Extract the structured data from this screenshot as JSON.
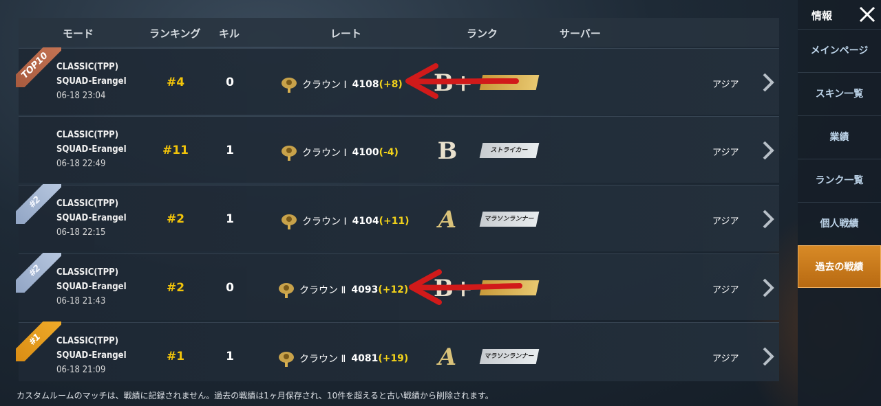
{
  "header": {
    "mode": "モード",
    "ranking": "ランキング",
    "kills": "キル",
    "rate": "レート",
    "rank": "ランク",
    "server": "サーバー"
  },
  "rows": [
    {
      "badge": "TOP10",
      "mode": "CLASSIC(TPP)",
      "map": "SQUAD-Erangel",
      "time": "06-18 23:04",
      "ranking": "#4",
      "kills": "0",
      "tier": "クラウン Ⅰ",
      "rate": "4108",
      "delta": "(+8)",
      "grade": "B+",
      "title": "",
      "server": "アジア"
    },
    {
      "badge": "",
      "mode": "CLASSIC(TPP)",
      "map": "SQUAD-Erangel",
      "time": "06-18 22:49",
      "ranking": "#11",
      "kills": "1",
      "tier": "クラウン Ⅰ",
      "rate": "4100",
      "delta": "(-4)",
      "grade": "B",
      "title": "ストライカー",
      "server": "アジア"
    },
    {
      "badge": "#2",
      "mode": "CLASSIC(TPP)",
      "map": "SQUAD-Erangel",
      "time": "06-18 22:15",
      "ranking": "#2",
      "kills": "1",
      "tier": "クラウン Ⅰ",
      "rate": "4104",
      "delta": "(+11)",
      "grade": "A",
      "title": "マラソンランナー",
      "server": "アジア"
    },
    {
      "badge": "#2",
      "mode": "CLASSIC(TPP)",
      "map": "SQUAD-Erangel",
      "time": "06-18 21:43",
      "ranking": "#2",
      "kills": "0",
      "tier": "クラウン Ⅱ",
      "rate": "4093",
      "delta": "(+12)",
      "grade": "B+",
      "title": "",
      "server": "アジア"
    },
    {
      "badge": "#1",
      "mode": "CLASSIC(TPP)",
      "map": "SQUAD-Erangel",
      "time": "06-18 21:09",
      "ranking": "#1",
      "kills": "1",
      "tier": "クラウン Ⅱ",
      "rate": "4081",
      "delta": "(+19)",
      "grade": "A",
      "title": "マラソンランナー",
      "server": "アジア"
    }
  ],
  "note": "カスタムルームのマッチは、戦績に記録されません。過去の戦績は1ヶ月保存され、10件を超えると古い戦績から削除されます。",
  "sidebar": {
    "title": "情報",
    "items": [
      {
        "label": "メインページ"
      },
      {
        "label": "スキン一覧"
      },
      {
        "label": "業績"
      },
      {
        "label": "ランク一覧"
      },
      {
        "label": "個人戦績"
      },
      {
        "label": "過去の戦績",
        "active": true
      }
    ]
  },
  "colors": {
    "accent": "#d88a26",
    "ranking": "#f2c40a",
    "delta": "#f2d21a",
    "annotation_arrow": "#d11a1a"
  },
  "icons": {
    "crown": "crown-tier-icon",
    "chevron": "chevron-right-icon",
    "close": "close-icon"
  }
}
